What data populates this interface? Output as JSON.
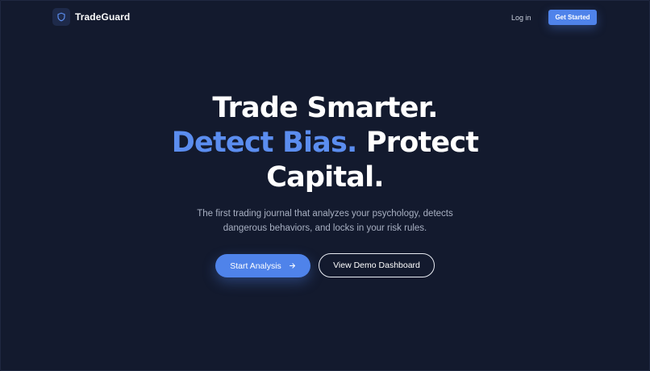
{
  "header": {
    "brand_name": "TradeGuard",
    "login_label": "Log in",
    "get_started_label": "Get Started",
    "brand_icon": "shield-icon"
  },
  "hero": {
    "title_line1": "Trade Smarter.",
    "title_accent": "Detect Bias.",
    "title_rest": "Protect",
    "title_line3": "Capital.",
    "subtitle_line1": "The first trading journal that analyzes your psychology, detects",
    "subtitle_line2": "dangerous behaviors, and locks in your risk rules.",
    "primary_cta": "Start Analysis",
    "primary_cta_icon": "arrow-right-icon",
    "secondary_cta": "View Demo Dashboard"
  },
  "colors": {
    "background": "#131a2e",
    "accent": "#4f83ea",
    "accent_text": "#5b8def",
    "text": "#ffffff",
    "muted_text": "#a8b0c2"
  }
}
